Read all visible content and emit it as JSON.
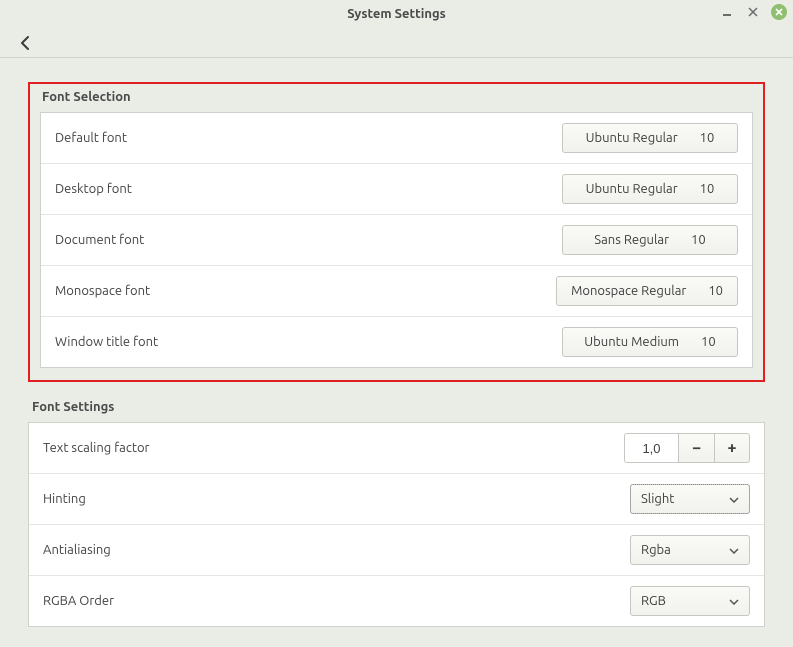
{
  "window": {
    "title": "System Settings"
  },
  "fontSelection": {
    "heading": "Font Selection",
    "rows": [
      {
        "label": "Default font",
        "font": "Ubuntu Regular",
        "size": "10"
      },
      {
        "label": "Desktop font",
        "font": "Ubuntu Regular",
        "size": "10"
      },
      {
        "label": "Document font",
        "font": "Sans Regular",
        "size": "10"
      },
      {
        "label": "Monospace font",
        "font": "Monospace Regular",
        "size": "10"
      },
      {
        "label": "Window title font",
        "font": "Ubuntu Medium",
        "size": "10"
      }
    ]
  },
  "fontSettings": {
    "heading": "Font Settings",
    "scaling": {
      "label": "Text scaling factor",
      "value": "1,0"
    },
    "hinting": {
      "label": "Hinting",
      "value": "Slight"
    },
    "antialias": {
      "label": "Antialiasing",
      "value": "Rgba"
    },
    "rgbaOrder": {
      "label": "RGBA Order",
      "value": "RGB"
    }
  }
}
